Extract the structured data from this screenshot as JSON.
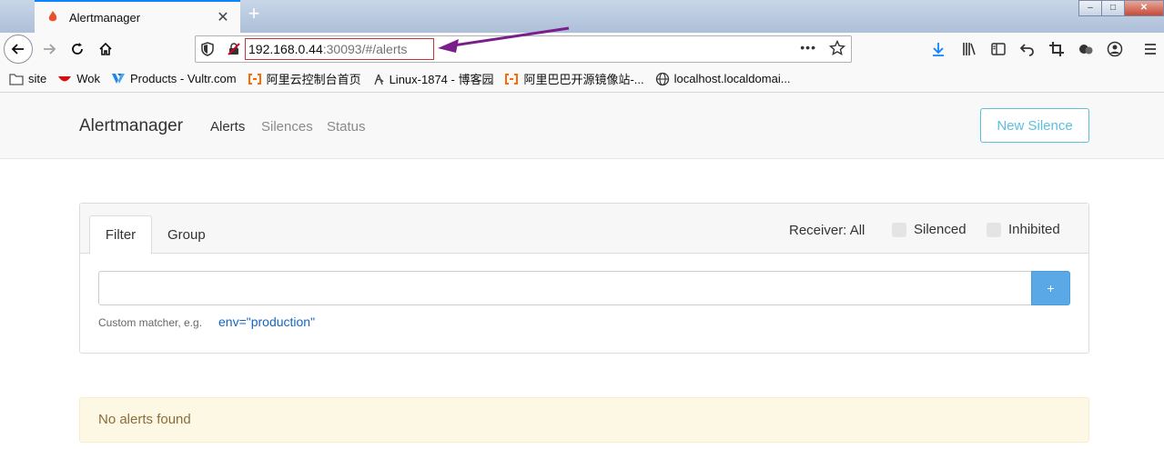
{
  "browser": {
    "tab": {
      "title": "Alertmanager",
      "close": "✕"
    },
    "new_tab": "+",
    "window_controls": {
      "minimize": "–",
      "maximize": "□",
      "close": "✕"
    },
    "url": {
      "host": "192.168.0.44",
      "rest": ":30093/#/alerts",
      "more": "•••"
    },
    "bookmarks": [
      {
        "label": "site",
        "icon": "folder-icon"
      },
      {
        "label": "Wok",
        "icon": "wok-icon"
      },
      {
        "label": "Products - Vultr.com",
        "icon": "vultr-icon"
      },
      {
        "label": "阿里云控制台首页",
        "icon": "aliyun-icon"
      },
      {
        "label": "Linux-1874 - 博客园",
        "icon": "cnblogs-icon"
      },
      {
        "label": "阿里巴巴开源镜像站-...",
        "icon": "aliyun-icon"
      },
      {
        "label": "localhost.localdomai...",
        "icon": "globe-icon"
      }
    ]
  },
  "app": {
    "brand": "Alertmanager",
    "nav": {
      "alerts": "Alerts",
      "silences": "Silences",
      "status": "Status"
    },
    "new_silence": "New Silence",
    "filter_card": {
      "tab_filter": "Filter",
      "tab_group": "Group",
      "receiver": "Receiver: All",
      "silenced": "Silenced",
      "inhibited": "Inhibited",
      "add_button": "+",
      "hint": "Custom matcher, e.g.",
      "hint_example": "env=\"production\""
    },
    "empty_message": "No alerts found"
  },
  "colors": {
    "accent_tab": "#0a84ff",
    "new_silence": "#5bc0de",
    "add_button": "#5aa9e6",
    "warning_bg": "#fcf8e3",
    "warning_text": "#8a6d3b",
    "annotation_arrow": "#7a1f8a",
    "url_highlight": "#c73838"
  }
}
